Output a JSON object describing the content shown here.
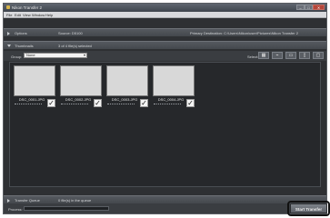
{
  "window": {
    "title": "Nikon Transfer 2",
    "controls": {
      "minimize": "–",
      "maximize": "□",
      "close": "✕"
    }
  },
  "menu": {
    "items": [
      "File",
      "Edit",
      "View",
      "Window",
      "Help"
    ]
  },
  "options_bar": {
    "label": "Options",
    "source_label": "Source: D5100",
    "destination_label": "Primary Destination: C:\\Users\\Nikon\\user\\Pictures\\Nikon Transfer 2"
  },
  "thumbnails_bar": {
    "label": "Thumbnails",
    "summary": "3 of 4 file(s) selected"
  },
  "toolbar": {
    "group_label": "Group:",
    "group_value": "None",
    "select_label": "Select:",
    "buttons": [
      "▦",
      "⌁",
      "▭",
      "▯",
      "▢"
    ]
  },
  "thumbnails": [
    {
      "filename": "DSC_0001.JPG",
      "checked": true,
      "check_mark": "✓"
    },
    {
      "filename": "DSC_0002.JPG",
      "checked": true,
      "check_mark": "✓"
    },
    {
      "filename": "DSC_0003.JPG",
      "checked": true,
      "check_mark": "✓"
    },
    {
      "filename": "DSC_0004.JPG",
      "checked": true,
      "check_mark": "✓"
    }
  ],
  "queue_bar": {
    "label": "Transfer Queue",
    "summary": "0 file(s) in the queue"
  },
  "status": {
    "process_label": "Process:",
    "progress_fraction": 0,
    "start_button_label": "Start Transfer"
  },
  "colors": {
    "window_bg": "#2e3033",
    "accent_progress": "#4aa0d8"
  }
}
